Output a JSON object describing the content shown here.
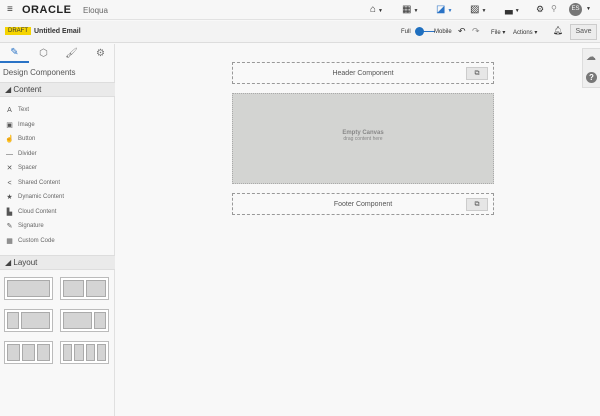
{
  "topbar": {
    "logo": "ORACLE",
    "product": "Eloqua",
    "avatar": "ES"
  },
  "toolbar": {
    "status_badge": "DRAFT",
    "email_name": "Untitled Email",
    "view_full": "Full",
    "view_mobile": "Mobile",
    "file_menu": "File",
    "actions_menu": "Actions",
    "save": "Save"
  },
  "sidebar": {
    "title": "Design Components",
    "content_header": "Content",
    "items": [
      {
        "label": "Text",
        "icon": "A"
      },
      {
        "label": "Image",
        "icon": "▣"
      },
      {
        "label": "Button",
        "icon": "☝"
      },
      {
        "label": "Divider",
        "icon": "—"
      },
      {
        "label": "Spacer",
        "icon": "✕"
      },
      {
        "label": "Shared Content",
        "icon": "<"
      },
      {
        "label": "Dynamic Content",
        "icon": "★"
      },
      {
        "label": "Cloud Content",
        "icon": "▙"
      },
      {
        "label": "Signature",
        "icon": "✎"
      },
      {
        "label": "Custom Code",
        "icon": "▦"
      }
    ],
    "layout_header": "Layout"
  },
  "canvas": {
    "header": "Header Component",
    "empty_title": "Empty Canvas",
    "empty_sub": "drag content here",
    "footer": "Footer Component"
  }
}
